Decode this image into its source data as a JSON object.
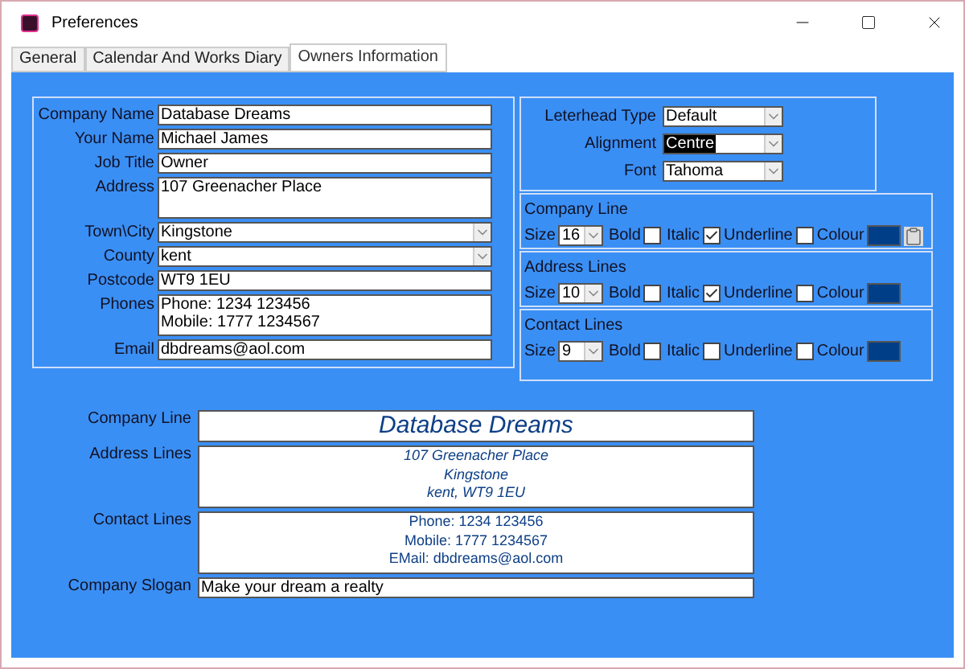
{
  "window": {
    "title": "Preferences"
  },
  "tabs": [
    {
      "label": "General",
      "selected": false
    },
    {
      "label": "Calendar And Works Diary",
      "selected": false
    },
    {
      "label": "Owners Information",
      "selected": true
    }
  ],
  "owner_fields": [
    {
      "label": "Company Name",
      "value": "Database Dreams",
      "kind": "text"
    },
    {
      "label": "Your Name",
      "value": "Michael James",
      "kind": "text"
    },
    {
      "label": "Job Title",
      "value": "Owner",
      "kind": "text"
    },
    {
      "label": "Address",
      "value": "107 Greenacher Place",
      "kind": "multiline"
    },
    {
      "label": "Town\\City",
      "value": "Kingstone",
      "kind": "dropdown"
    },
    {
      "label": "County",
      "value": "kent",
      "kind": "dropdown"
    },
    {
      "label": "Postcode",
      "value": "WT9 1EU",
      "kind": "text"
    },
    {
      "label": "Phones",
      "value": "Phone: 1234 123456\nMobile: 1777 1234567",
      "kind": "multiline"
    },
    {
      "label": "Email",
      "value": "dbdreams@aol.com",
      "kind": "text"
    }
  ],
  "letterhead": [
    {
      "label": "Leterhead Type",
      "value": "Default",
      "highlighted": false
    },
    {
      "label": "Alignment",
      "value": "Centre",
      "highlighted": true
    },
    {
      "label": "Font",
      "value": "Tahoma",
      "highlighted": false
    }
  ],
  "line_styles": [
    {
      "title": "Company Line",
      "size_label": "Size",
      "size": "16",
      "bold_label": "Bold",
      "bold": false,
      "italic_label": "Italic",
      "italic": true,
      "underline_label": "Underline",
      "underline": false,
      "colour_label": "Colour",
      "color": "#003f87",
      "paste_button": true
    },
    {
      "title": "Address Lines",
      "size_label": "Size",
      "size": "10",
      "bold_label": "Bold",
      "bold": false,
      "italic_label": "Italic",
      "italic": true,
      "underline_label": "Underline",
      "underline": false,
      "colour_label": "Colour",
      "color": "#003f87",
      "paste_button": false
    },
    {
      "title": "Contact Lines",
      "size_label": "Size",
      "size": "9",
      "bold_label": "Bold",
      "bold": false,
      "italic_label": "Italic",
      "italic": false,
      "underline_label": "Underline",
      "underline": false,
      "colour_label": "Colour",
      "color": "#003f87",
      "paste_button": false
    }
  ],
  "preview": [
    {
      "label": "Company Line",
      "kind": "large",
      "lines": [
        "Database Dreams"
      ]
    },
    {
      "label": "Address Lines",
      "kind": "block",
      "lines": [
        "107 Greenacher Place",
        "Kingstone",
        "kent, WT9 1EU"
      ]
    },
    {
      "label": "Contact Lines",
      "kind": "block",
      "lines": [
        "Phone: 1234 123456",
        "Mobile: 1777 1234567",
        "EMail: dbdreams@aol.com"
      ]
    },
    {
      "label": "Company Slogan",
      "kind": "field",
      "lines": [
        "Make your dream a realty"
      ]
    }
  ]
}
